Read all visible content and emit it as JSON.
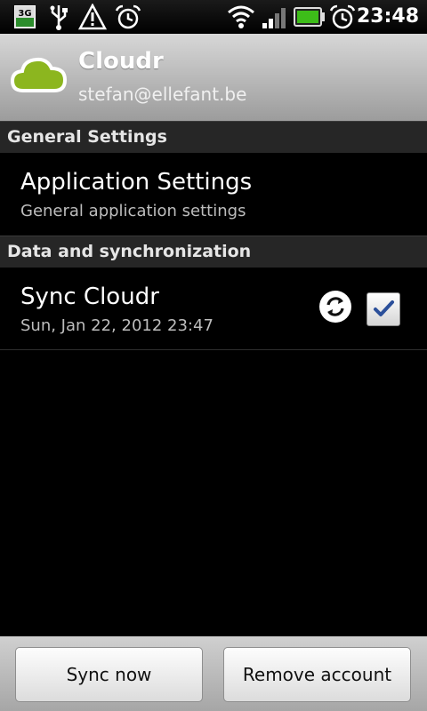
{
  "status_bar": {
    "time": "23:48",
    "network_label": "3G",
    "icons": [
      "3g-data-icon",
      "usb-icon",
      "warning-icon",
      "alarm-icon",
      "wifi-icon",
      "signal-icon",
      "battery-icon",
      "alarm-clock-icon"
    ]
  },
  "account": {
    "name": "Cloudr",
    "email": "stefan@ellefant.be",
    "icon": "cloud-icon",
    "accent_color": "#8cb61f"
  },
  "sections": [
    {
      "header": "General Settings",
      "items": [
        {
          "title": "Application Settings",
          "summary": "General application settings"
        }
      ]
    },
    {
      "header": "Data and synchronization",
      "items": [
        {
          "title": "Sync Cloudr",
          "summary": "Sun, Jan 22, 2012 23:47",
          "sync_icon": "sync-icon",
          "checked": true
        }
      ]
    }
  ],
  "buttons": {
    "sync_now": "Sync now",
    "remove_account": "Remove account"
  }
}
